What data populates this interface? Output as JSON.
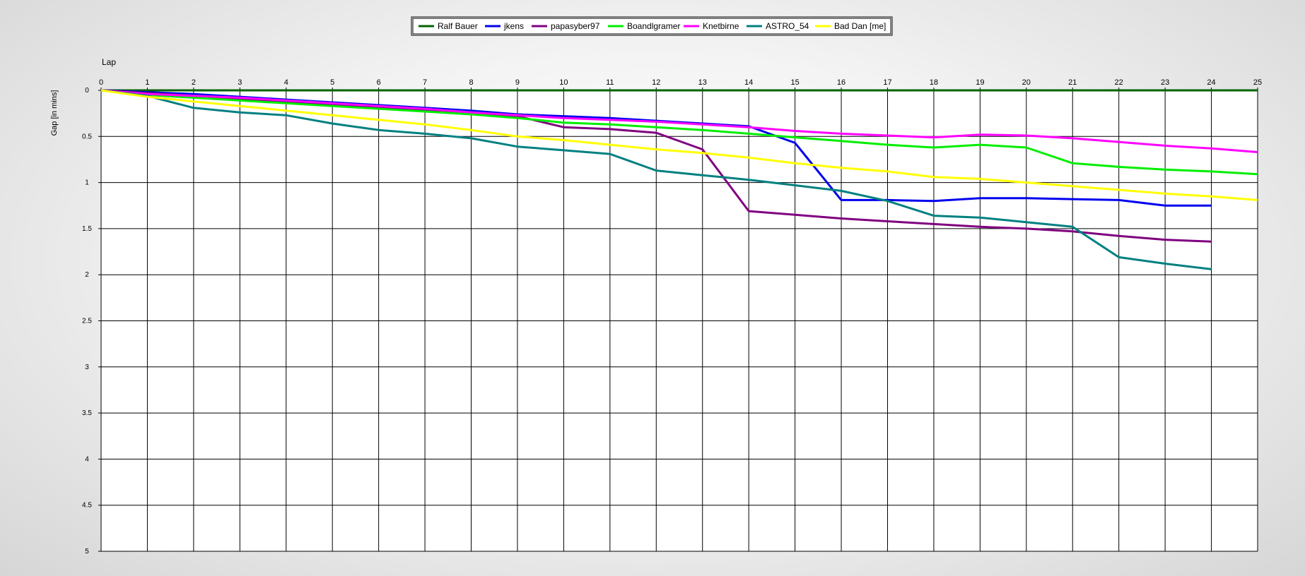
{
  "chart_data": {
    "type": "line",
    "title": "",
    "xlabel": "Lap",
    "ylabel": "Gap [in mins]",
    "xlim": [
      0,
      25
    ],
    "ylim": [
      0,
      5
    ],
    "y_inverted": true,
    "x_ticks": [
      0,
      1,
      2,
      3,
      4,
      5,
      6,
      7,
      8,
      9,
      10,
      11,
      12,
      13,
      14,
      15,
      16,
      17,
      18,
      19,
      20,
      21,
      22,
      23,
      24,
      25
    ],
    "y_ticks": [
      0,
      0.5,
      1,
      1.5,
      2,
      2.5,
      3,
      3.5,
      4,
      4.5,
      5
    ],
    "y_tick_labels": [
      "0",
      "0.5",
      "1",
      "1.5",
      "2",
      "2.5",
      "3",
      "3.5",
      "4",
      "4.5",
      "5"
    ],
    "grid": true,
    "legend_position": "top-center",
    "series": [
      {
        "name": "Ralf Bauer",
        "color": "#006400",
        "x": [
          0,
          1,
          2,
          3,
          4,
          5,
          6,
          7,
          8,
          9,
          10,
          11,
          12,
          13,
          14,
          15,
          16,
          17,
          18,
          19,
          20,
          21,
          22,
          23,
          24,
          25
        ],
        "values": [
          0,
          0,
          0,
          0,
          0,
          0,
          0,
          0,
          0,
          0,
          0,
          0,
          0,
          0,
          0,
          0,
          0,
          0,
          0,
          0,
          0,
          0,
          0,
          0,
          0,
          0
        ]
      },
      {
        "name": "jkens",
        "color": "#0000ee",
        "x": [
          0,
          1,
          2,
          3,
          4,
          5,
          6,
          7,
          8,
          9,
          10,
          11,
          12,
          13,
          14,
          15,
          16,
          17,
          18,
          19,
          20,
          21,
          22,
          23,
          24
        ],
        "values": [
          0,
          0.02,
          0.04,
          0.07,
          0.1,
          0.13,
          0.16,
          0.19,
          0.22,
          0.26,
          0.28,
          0.3,
          0.33,
          0.36,
          0.39,
          0.57,
          1.19,
          1.19,
          1.2,
          1.17,
          1.17,
          1.18,
          1.19,
          1.25,
          1.25
        ]
      },
      {
        "name": "papasyber97",
        "color": "#800080",
        "x": [
          0,
          1,
          2,
          3,
          4,
          5,
          6,
          7,
          8,
          9,
          10,
          11,
          12,
          13,
          14,
          15,
          16,
          17,
          18,
          19,
          20,
          21,
          22,
          23,
          24
        ],
        "values": [
          0,
          0.03,
          0.06,
          0.09,
          0.12,
          0.15,
          0.18,
          0.21,
          0.24,
          0.28,
          0.4,
          0.42,
          0.46,
          0.64,
          1.31,
          1.35,
          1.39,
          1.42,
          1.45,
          1.48,
          1.5,
          1.53,
          1.58,
          1.62,
          1.64
        ]
      },
      {
        "name": "Boandlgramer",
        "color": "#00ee00",
        "x": [
          0,
          1,
          2,
          3,
          4,
          5,
          6,
          7,
          8,
          9,
          10,
          11,
          12,
          13,
          14,
          15,
          16,
          17,
          18,
          19,
          20,
          21,
          22,
          23,
          24,
          25
        ],
        "values": [
          0,
          0.05,
          0.08,
          0.11,
          0.14,
          0.17,
          0.2,
          0.23,
          0.26,
          0.3,
          0.35,
          0.37,
          0.4,
          0.43,
          0.47,
          0.51,
          0.55,
          0.59,
          0.62,
          0.59,
          0.62,
          0.79,
          0.83,
          0.86,
          0.88,
          0.91
        ]
      },
      {
        "name": "Knetbirne",
        "color": "#ff00ff",
        "x": [
          0,
          1,
          2,
          3,
          4,
          5,
          6,
          7,
          8,
          9,
          10,
          11,
          12,
          13,
          14,
          15,
          16,
          17,
          18,
          19,
          20,
          21,
          22,
          23,
          24,
          25
        ],
        "values": [
          0,
          0.04,
          0.06,
          0.08,
          0.11,
          0.14,
          0.17,
          0.2,
          0.24,
          0.27,
          0.3,
          0.32,
          0.34,
          0.37,
          0.4,
          0.44,
          0.47,
          0.49,
          0.51,
          0.48,
          0.49,
          0.52,
          0.56,
          0.6,
          0.63,
          0.67
        ]
      },
      {
        "name": "ASTRO_54",
        "color": "#008080",
        "x": [
          0,
          1,
          2,
          3,
          4,
          5,
          6,
          7,
          8,
          9,
          10,
          11,
          12,
          13,
          14,
          15,
          16,
          17,
          18,
          19,
          20,
          21,
          22,
          23,
          24
        ],
        "values": [
          0,
          0.06,
          0.19,
          0.24,
          0.27,
          0.36,
          0.43,
          0.47,
          0.52,
          0.61,
          0.65,
          0.69,
          0.87,
          0.92,
          0.97,
          1.03,
          1.09,
          1.2,
          1.36,
          1.38,
          1.43,
          1.48,
          1.81,
          1.88,
          1.94
        ]
      },
      {
        "name": "Bad Dan [me]",
        "color": "#ffff00",
        "x": [
          0,
          1,
          2,
          3,
          4,
          5,
          6,
          7,
          8,
          9,
          10,
          11,
          12,
          13,
          14,
          15,
          16,
          17,
          18,
          19,
          20,
          21,
          22,
          23,
          24,
          25
        ],
        "values": [
          0,
          0.07,
          0.12,
          0.17,
          0.22,
          0.27,
          0.32,
          0.37,
          0.43,
          0.5,
          0.54,
          0.59,
          0.64,
          0.68,
          0.73,
          0.79,
          0.84,
          0.88,
          0.94,
          0.96,
          1.0,
          1.04,
          1.08,
          1.12,
          1.15,
          1.19
        ]
      }
    ]
  }
}
